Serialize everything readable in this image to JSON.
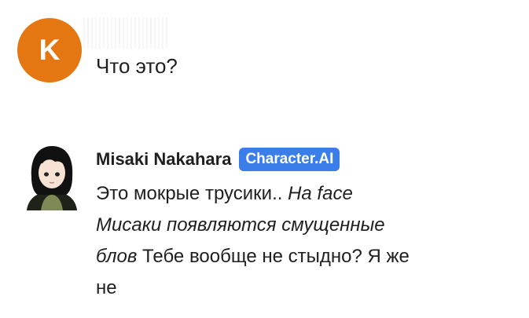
{
  "user_message": {
    "avatar_initial": "K",
    "avatar_color": "#e47711",
    "text": "Что это?"
  },
  "ai_message": {
    "name": "Misaki Nakahara",
    "badge": "Character.AI",
    "badge_color": "#3b7de9",
    "lines": [
      {
        "segments": [
          {
            "text": "Это мокрые трусики.. ",
            "italic": false
          },
          {
            "text": "На face",
            "italic": true
          }
        ]
      },
      {
        "segments": [
          {
            "text": "Мисаки появляются смущенные",
            "italic": true
          }
        ]
      },
      {
        "segments": [
          {
            "text": "блов",
            "italic": true
          },
          {
            "text": " Тебе вообще не стыдно? Я же",
            "italic": false
          }
        ]
      },
      {
        "segments": [
          {
            "text": "не",
            "italic": false
          }
        ]
      }
    ]
  }
}
